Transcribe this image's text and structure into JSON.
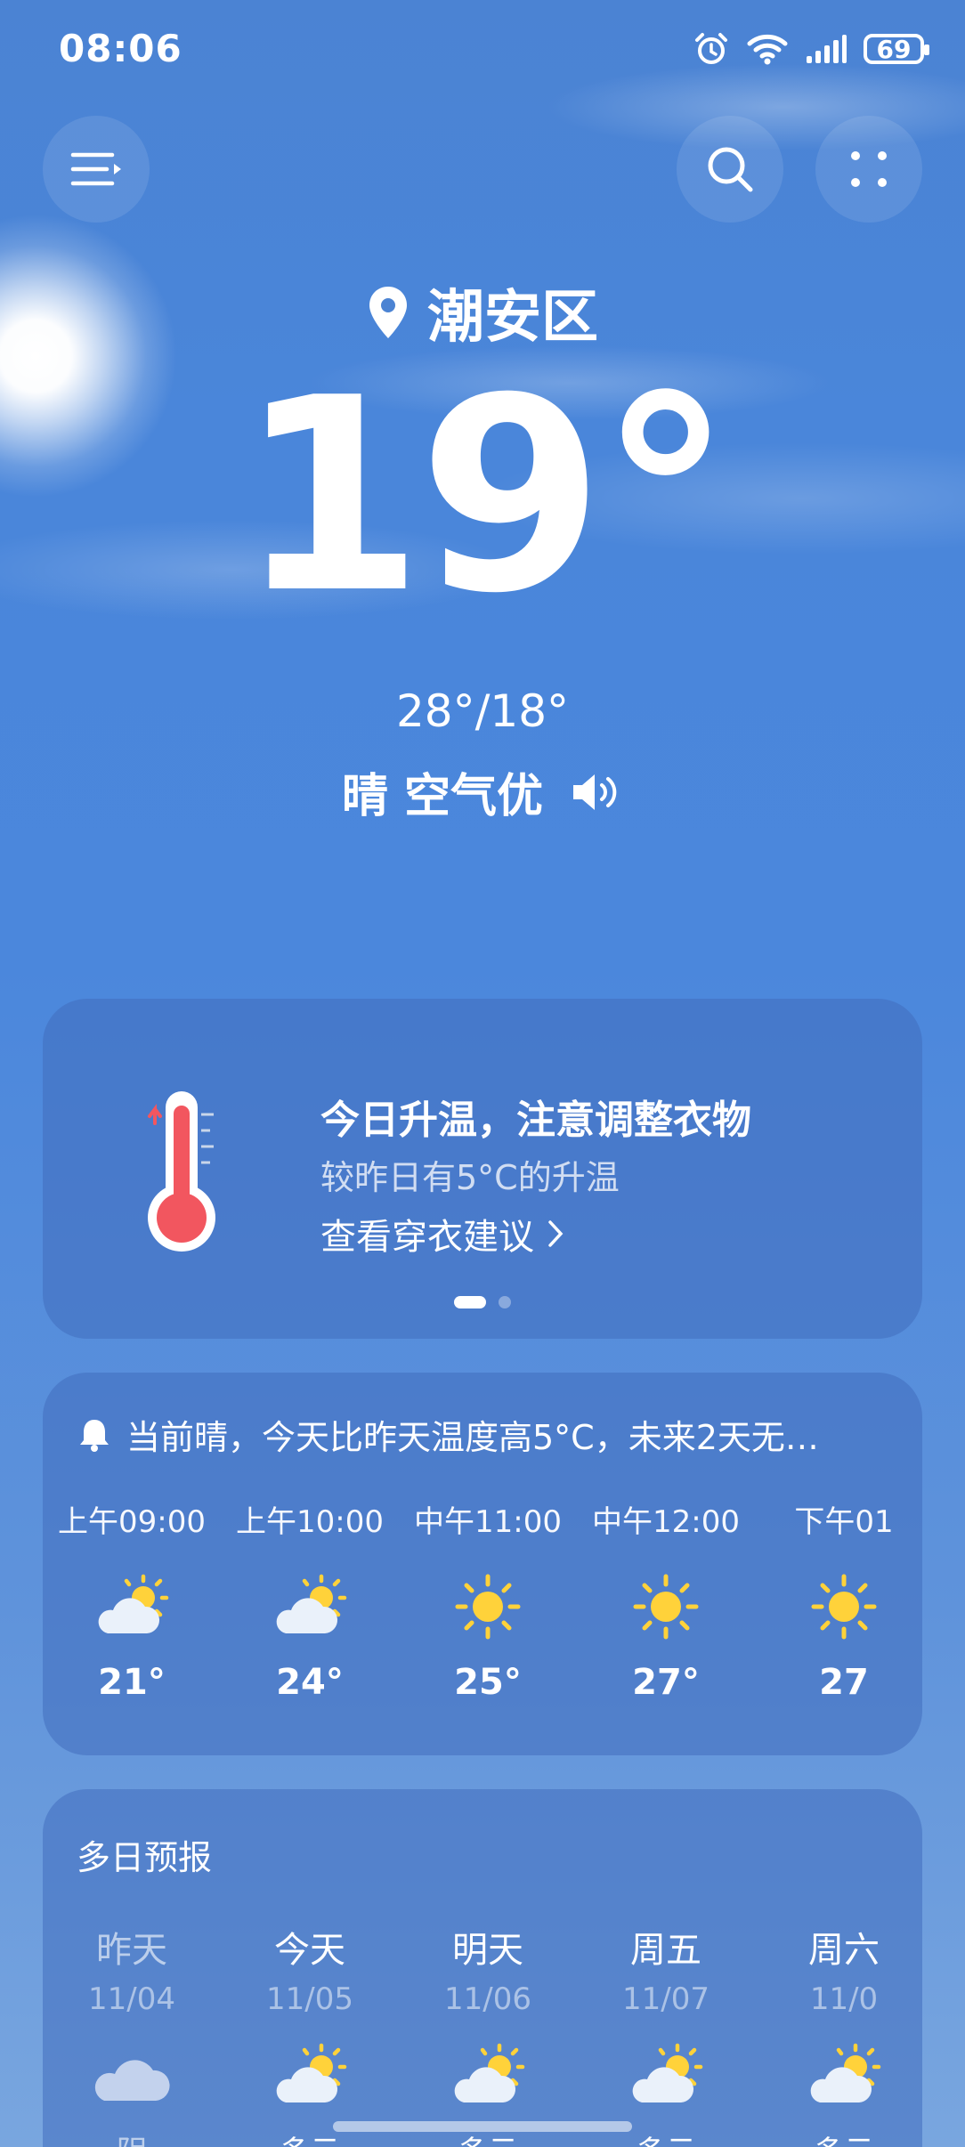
{
  "status_bar": {
    "time": "08:06",
    "battery": "69"
  },
  "header": {
    "menu_icon": "menu-icon",
    "search_icon": "search-icon",
    "more_icon": "grid-dots-icon"
  },
  "location": {
    "name": "潮安区"
  },
  "current": {
    "temp": "19°",
    "high_low": "28°/18°",
    "condition": "晴 空气优"
  },
  "tip_card": {
    "title": "今日升温，注意调整衣物",
    "subtitle": "较昨日有5°C的升温",
    "link": "查看穿衣建议",
    "page_index": 1,
    "page_count": 2
  },
  "hourly": {
    "alert": "当前晴，今天比昨天温度高5°C，未来2天无…",
    "items": [
      {
        "time": "上午09:00",
        "icon": "partly-cloudy-icon",
        "temp": "21°"
      },
      {
        "time": "上午10:00",
        "icon": "partly-cloudy-icon",
        "temp": "24°"
      },
      {
        "time": "中午11:00",
        "icon": "sunny-icon",
        "temp": "25°"
      },
      {
        "time": "中午12:00",
        "icon": "sunny-icon",
        "temp": "27°"
      },
      {
        "time": "下午01",
        "icon": "sunny-icon",
        "temp": "27"
      }
    ]
  },
  "daily": {
    "title": "多日预报",
    "items": [
      {
        "day": "昨天",
        "date": "11/04",
        "icon": "cloudy-icon",
        "condition": "阴"
      },
      {
        "day": "今天",
        "date": "11/05",
        "icon": "partly-cloudy-icon",
        "condition": "多云"
      },
      {
        "day": "明天",
        "date": "11/06",
        "icon": "partly-cloudy-icon",
        "condition": "多云"
      },
      {
        "day": "周五",
        "date": "11/07",
        "icon": "partly-cloudy-icon",
        "condition": "多云"
      },
      {
        "day": "周六",
        "date": "11/0",
        "icon": "partly-cloudy-icon",
        "condition": "多云"
      }
    ]
  },
  "colors": {
    "sun_yellow": "#ffd23a",
    "thermo_red": "#f2565f",
    "sky_blue": "#4a86da"
  }
}
